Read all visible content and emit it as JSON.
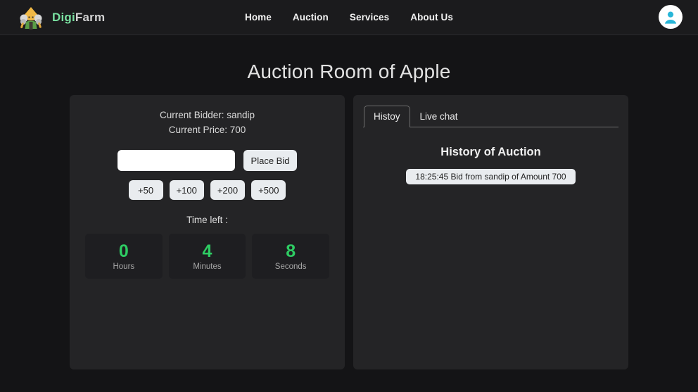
{
  "navbar": {
    "brand_digi": "Digi",
    "brand_farm": "Farm",
    "logo_icon": "farmer-logo-icon",
    "links": [
      {
        "label": "Home"
      },
      {
        "label": "Auction"
      },
      {
        "label": "Services"
      },
      {
        "label": "About Us"
      }
    ],
    "avatar_icon": "user-avatar-icon",
    "colors": {
      "brand_green": "#79e0a0",
      "brand_gray": "#d2d2d2",
      "avatar_person": "#29b6d8",
      "navbar_bg": "#1b1b1d"
    }
  },
  "page": {
    "title": "Auction Room of Apple",
    "background": "#141416",
    "panel_background": "#242426"
  },
  "auction": {
    "current_bidder_label": "Current Bidder: sandip",
    "current_price_label": "Current Price: 700",
    "bid_input_value": "",
    "bid_input_placeholder": "",
    "place_bid_label": "Place Bid",
    "quick_bids": [
      {
        "label": "+50"
      },
      {
        "label": "+100"
      },
      {
        "label": "+200"
      },
      {
        "label": "+500"
      }
    ],
    "time_left_label": "Time left :",
    "timer": [
      {
        "value": "0",
        "unit": "Hours"
      },
      {
        "value": "4",
        "unit": "Minutes"
      },
      {
        "value": "8",
        "unit": "Seconds"
      }
    ],
    "timer_color": "#2ecc63"
  },
  "side_panel": {
    "tabs": [
      {
        "label": "Histoy",
        "active": true
      },
      {
        "label": "Live chat",
        "active": false
      }
    ],
    "history_title": "History of Auction",
    "history_items": [
      {
        "text": "18:25:45 Bid from sandip of Amount 700"
      }
    ]
  }
}
